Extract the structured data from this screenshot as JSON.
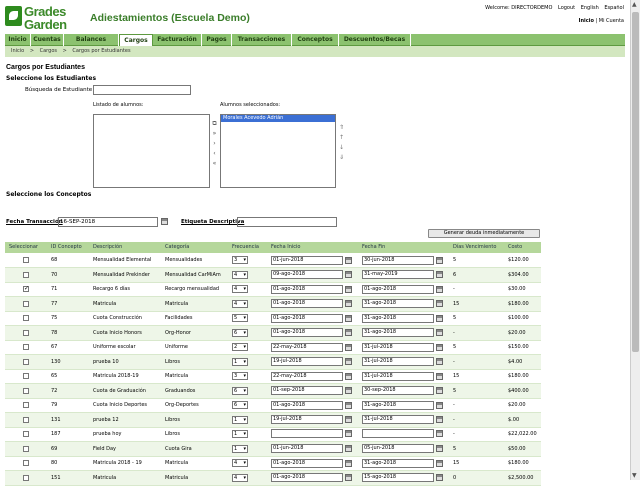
{
  "header": {
    "logo_line1": "Grades",
    "logo_line2": "Garden",
    "school_name": "Adiestamientos (Escuela Demo)",
    "welcome": "Welcome: DIRECTORDEMO",
    "logout": "Logout",
    "english": "English",
    "espanol": "Español",
    "inicio": "Inicio",
    "separator": "|",
    "mi_cuenta": "Mi Cuenta"
  },
  "nav": {
    "tabs": [
      "Inicio",
      "Cuentas",
      "Balances",
      "Cargos",
      "Facturación",
      "Pagos",
      "Transacciones",
      "Conceptos",
      "Descuentos/Becas"
    ],
    "active": "Cargos"
  },
  "breadcrumb": [
    "Inicio",
    ">",
    "Cargos",
    ">",
    "Cargos por Estudiantes"
  ],
  "page_title": "Cargos por Estudiantes",
  "students": {
    "section_title": "Seleccione los Estudiantes",
    "search_label": "Búsqueda de Estudiante",
    "search_value": "",
    "list_label": "Listado de alumnos:",
    "selected_label": "Alumnos seleccionados:",
    "selected_items": [
      "Morales Acevedo Adrián"
    ],
    "move_buttons": [
      "⧉",
      "»",
      "›",
      "‹",
      "«"
    ],
    "order_buttons": [
      "⇑",
      "↑",
      "↓",
      "⇓"
    ]
  },
  "concepts": {
    "section_title": "Seleccione los Conceptos",
    "fecha_label": "Fecha Transacción",
    "fecha_value": "16-SEP-2018",
    "etiqueta_label": "Etiqueta Descriptiva",
    "etiqueta_value": "",
    "generate_button": "Generar deuda inmediatamente"
  },
  "table": {
    "headers": [
      "Seleccionar",
      "ID Concepto",
      "Descripción",
      "Categoría",
      "Frecuencia",
      "Fecha Inicio",
      "Fecha Fin",
      "Días Vencimiento",
      "Costo"
    ],
    "rows": [
      {
        "checked": false,
        "id": "68",
        "desc": "Mensualidad Elemental",
        "cat": "Mensualidades",
        "freq": "3",
        "start": "01-jun-2018",
        "end": "30-jun-2018",
        "dias": "5",
        "costo": "$120.00"
      },
      {
        "checked": false,
        "id": "70",
        "desc": "Mensualidad Prekinder",
        "cat": "Mensualidad CarMiAm",
        "freq": "4",
        "start": "09-ago-2018",
        "end": "31-may-2019",
        "dias": "6",
        "costo": "$304.00"
      },
      {
        "checked": true,
        "id": "71",
        "desc": "Recargo 6 días",
        "cat": "Recargo mensualidad",
        "freq": "4",
        "start": "01-ago-2018",
        "end": "01-ago-2018",
        "dias": "-",
        "costo": "$30.00"
      },
      {
        "checked": false,
        "id": "77",
        "desc": "Matricula",
        "cat": "Matricula",
        "freq": "4",
        "start": "01-ago-2018",
        "end": "31-ago-2018",
        "dias": "15",
        "costo": "$180.00"
      },
      {
        "checked": false,
        "id": "75",
        "desc": "Cuota Construcción",
        "cat": "Facilidades",
        "freq": "5",
        "start": "01-ago-2018",
        "end": "31-ago-2018",
        "dias": "5",
        "costo": "$100.00"
      },
      {
        "checked": false,
        "id": "78",
        "desc": "Cuota Inicio Honors",
        "cat": "Org-Honor",
        "freq": "6",
        "start": "01-ago-2018",
        "end": "31-ago-2018",
        "dias": "-",
        "costo": "$20.00"
      },
      {
        "checked": false,
        "id": "67",
        "desc": "Uniforme escolar",
        "cat": "Uniforme",
        "freq": "2",
        "start": "22-may-2018",
        "end": "31-jul-2018",
        "dias": "5",
        "costo": "$150.00"
      },
      {
        "checked": false,
        "id": "130",
        "desc": "prueba 10",
        "cat": "Libros",
        "freq": "1",
        "start": "19-jul-2018",
        "end": "31-jul-2018",
        "dias": "-",
        "costo": "$4.00"
      },
      {
        "checked": false,
        "id": "65",
        "desc": "Matricula 2018-19",
        "cat": "Matricula",
        "freq": "3",
        "start": "22-may-2018",
        "end": "31-jul-2018",
        "dias": "15",
        "costo": "$180.00"
      },
      {
        "checked": false,
        "id": "72",
        "desc": "Cuota de Graduación",
        "cat": "Graduandos",
        "freq": "6",
        "start": "01-sep-2018",
        "end": "30-sep-2018",
        "dias": "5",
        "costo": "$400.00"
      },
      {
        "checked": false,
        "id": "79",
        "desc": "Cuota Inicio Deportes",
        "cat": "Org-Deportes",
        "freq": "6",
        "start": "01-ago-2018",
        "end": "31-ago-2018",
        "dias": "-",
        "costo": "$20.00"
      },
      {
        "checked": false,
        "id": "131",
        "desc": "prueba 12",
        "cat": "Libros",
        "freq": "1",
        "start": "19-jul-2018",
        "end": "31-jul-2018",
        "dias": "-",
        "costo": "$.00"
      },
      {
        "checked": false,
        "id": "187",
        "desc": "prueba hoy",
        "cat": "Libros",
        "freq": "1",
        "start": "",
        "end": "",
        "dias": "-",
        "costo": "$22,022.00"
      },
      {
        "checked": false,
        "id": "69",
        "desc": "Field Day",
        "cat": "Cuota Gira",
        "freq": "1",
        "start": "01-jun-2018",
        "end": "05-jun-2018",
        "dias": "5",
        "costo": "$50.00"
      },
      {
        "checked": false,
        "id": "80",
        "desc": "Matricula 2018 - 19",
        "cat": "Matricula",
        "freq": "4",
        "start": "01-ago-2018",
        "end": "31-ago-2018",
        "dias": "15",
        "costo": "$180.00"
      },
      {
        "checked": false,
        "id": "151",
        "desc": "Matricula",
        "cat": "Matricula",
        "freq": "4",
        "start": "01-ago-2018",
        "end": "15-ago-2018",
        "dias": "0",
        "costo": "$2,500.00"
      }
    ]
  }
}
